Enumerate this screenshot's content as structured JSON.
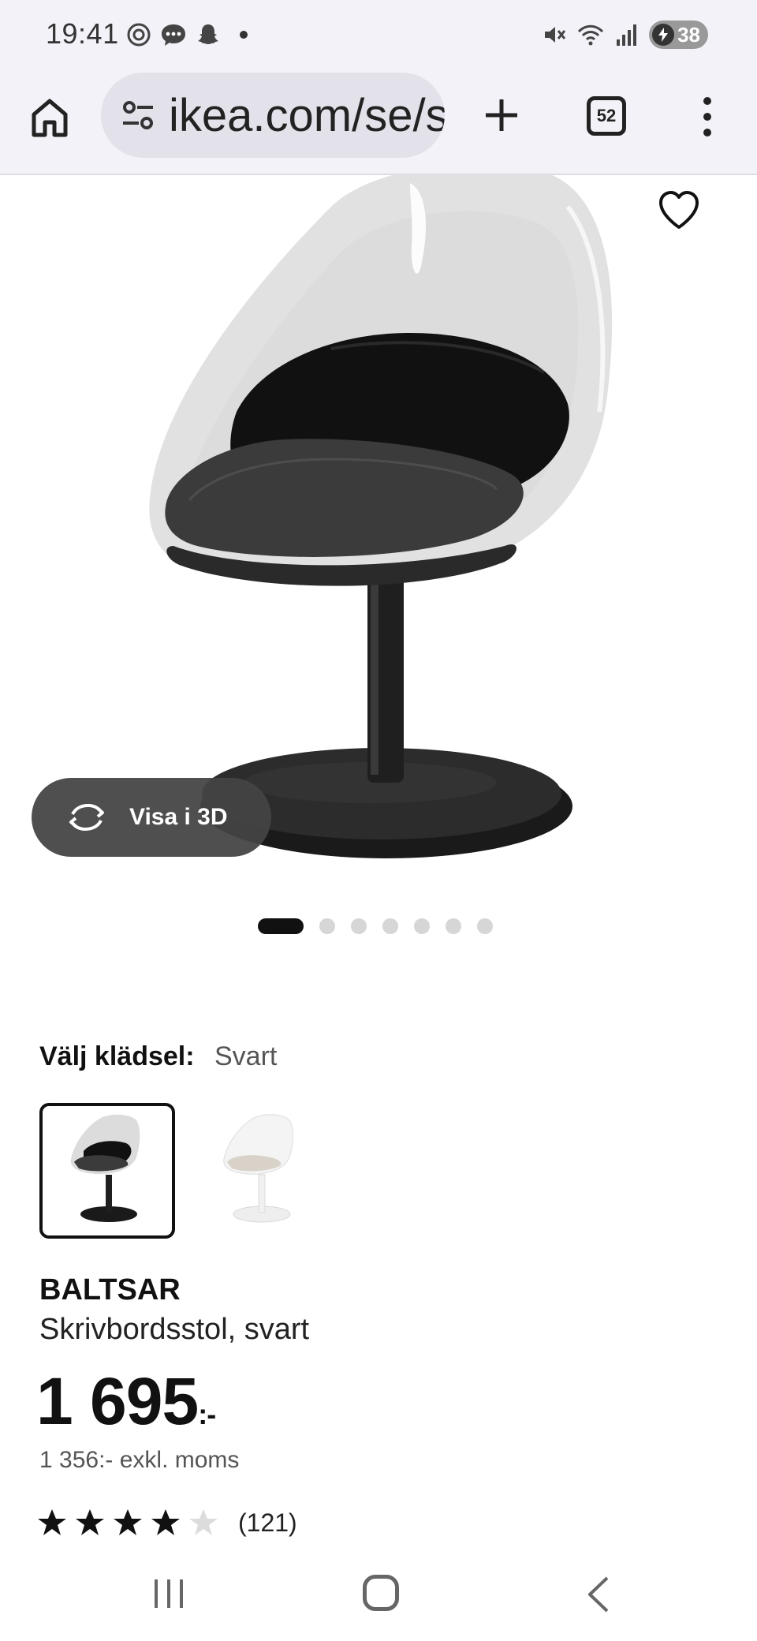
{
  "status_bar": {
    "time": "19:41",
    "left_icons": [
      "threads-icon",
      "chat-bubble-icon",
      "snapchat-icon",
      "dot-icon"
    ],
    "right_icons": [
      "mute-icon",
      "wifi-icon",
      "signal-icon"
    ],
    "battery_level": "38"
  },
  "browser": {
    "url_text": "ikea.com/se/sv/p/baltsar",
    "tabs_count": "52"
  },
  "product_image": {
    "view_3d_label": "Visa i 3D",
    "carousel_total": 7,
    "carousel_active": 1
  },
  "variant": {
    "label": "Välj klädsel:",
    "selected_value": "Svart",
    "options": [
      {
        "name": "svart",
        "selected": true
      },
      {
        "name": "vit",
        "selected": false
      }
    ]
  },
  "product": {
    "name": "BALTSAR",
    "description": "Skrivbordsstol, svart",
    "price_main": "1 695",
    "price_suffix": ":-",
    "price_ex_vat": "1 356:- exkl. moms",
    "rating_stars": 4,
    "rating_max": 5,
    "review_count": "(121)"
  },
  "colors": {
    "chrome_bg": "#f3f2f8",
    "url_pill_bg": "#e3e2ea",
    "pill_overlay": "#444444",
    "text_dark": "#111111",
    "text_muted": "#555555",
    "dot_inactive": "#d6d6d6"
  }
}
